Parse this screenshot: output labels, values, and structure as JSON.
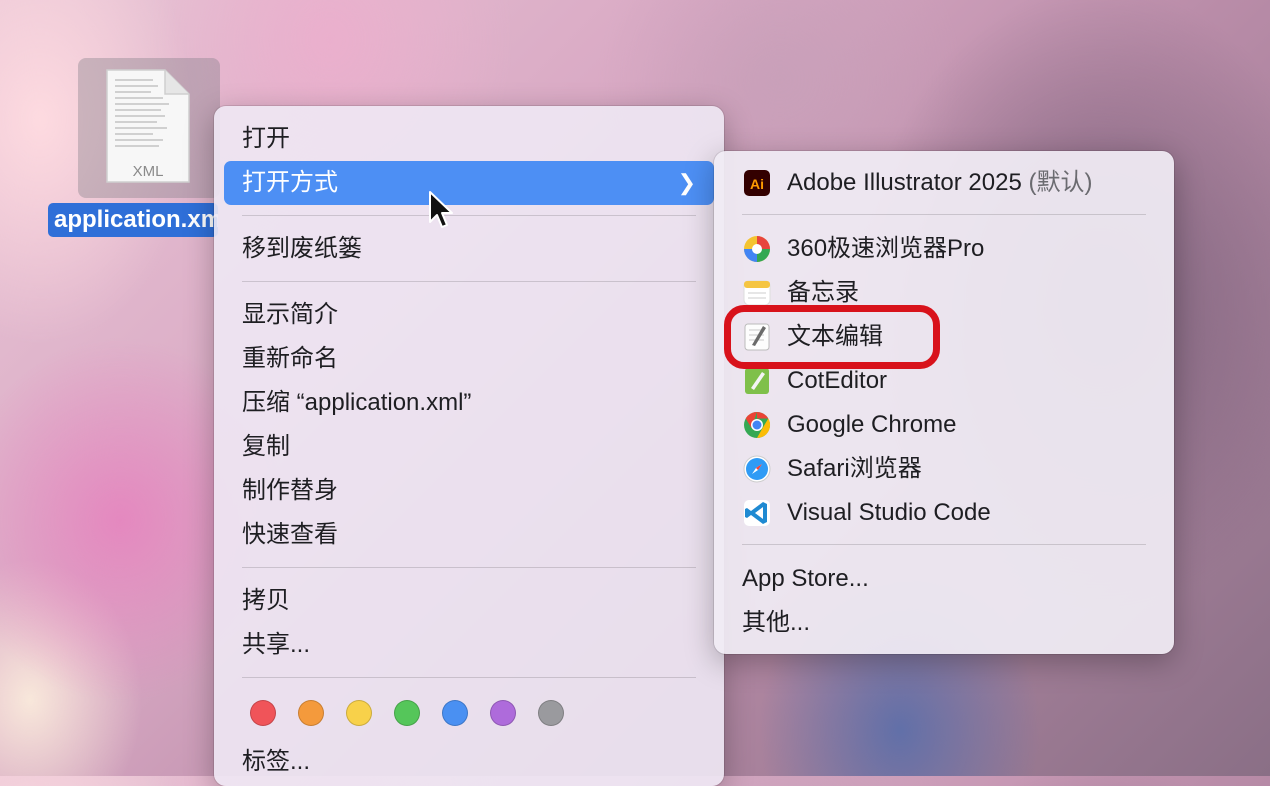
{
  "desktop": {
    "file_name": "application.xml",
    "file_badge": "XML"
  },
  "context_menu": {
    "items": [
      {
        "label": "打开"
      },
      {
        "label": "打开方式",
        "has_submenu": true,
        "active": true
      },
      {
        "label": "移到废纸篓"
      },
      {
        "label": "显示简介"
      },
      {
        "label": "重新命名"
      },
      {
        "label": "压缩 “application.xml”"
      },
      {
        "label": "复制"
      },
      {
        "label": "制作替身"
      },
      {
        "label": "快速查看"
      },
      {
        "label": "拷贝"
      },
      {
        "label": "共享..."
      },
      {
        "label": "标签..."
      }
    ],
    "tag_colors": [
      "#f05459",
      "#f49a3c",
      "#f8d14a",
      "#55c65a",
      "#4a90f2",
      "#ae6bdb",
      "#9a9a9e"
    ]
  },
  "open_with_menu": {
    "default_app": {
      "label": "Adobe Illustrator 2025",
      "suffix": "(默认)",
      "icon": "illustrator-icon"
    },
    "apps": [
      {
        "label": "360极速浏览器Pro",
        "icon": "360-browser-icon"
      },
      {
        "label": "备忘录",
        "icon": "notes-icon"
      },
      {
        "label": "文本编辑",
        "icon": "textedit-icon"
      },
      {
        "label": "CotEditor",
        "icon": "coteditor-icon"
      },
      {
        "label": "Google Chrome",
        "icon": "chrome-icon"
      },
      {
        "label": "Safari浏览器",
        "icon": "safari-icon"
      },
      {
        "label": "Visual Studio Code",
        "icon": "vscode-icon"
      }
    ],
    "app_store": "App Store...",
    "other": "其他..."
  },
  "colors": {
    "accent": "#4d8ff4",
    "highlight_outline": "#d8121b"
  }
}
